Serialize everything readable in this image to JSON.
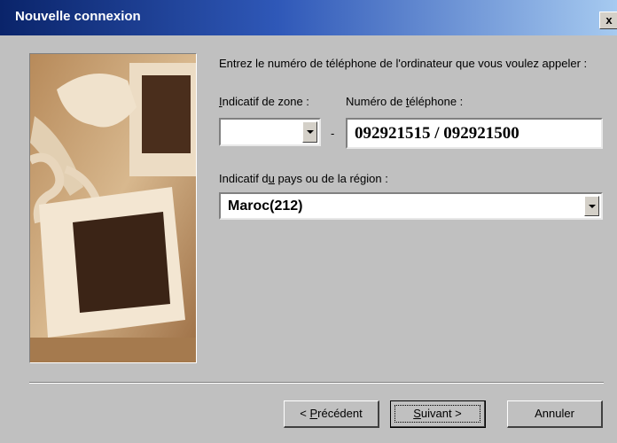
{
  "window": {
    "title": "Nouvelle connexion",
    "close_label": "x"
  },
  "form": {
    "instruction": "Entrez le numéro de téléphone de l'ordinateur que vous voulez appeler :",
    "area_code_label_mnemonic": "I",
    "area_code_label_rest": "ndicatif de zone :",
    "area_code_value": "",
    "dash": "-",
    "phone_label_prefix": "Numéro de ",
    "phone_label_mnemonic": "t",
    "phone_label_rest": "éléphone :",
    "phone_value": "092921515 / 092921500",
    "country_label_prefix": "Indicatif d",
    "country_label_mnemonic": "u",
    "country_label_rest": " pays ou de la région :",
    "country_value": "Maroc(212)"
  },
  "buttons": {
    "back": {
      "prefix": "< ",
      "mnemonic": "P",
      "rest": "récédent"
    },
    "next": {
      "mnemonic": "S",
      "rest": "uivant >"
    },
    "cancel": "Annuler"
  },
  "colors": {
    "titlebar_start": "#0a246a",
    "titlebar_end": "#a6caf0",
    "dialog_bg": "#c0c0c0"
  }
}
